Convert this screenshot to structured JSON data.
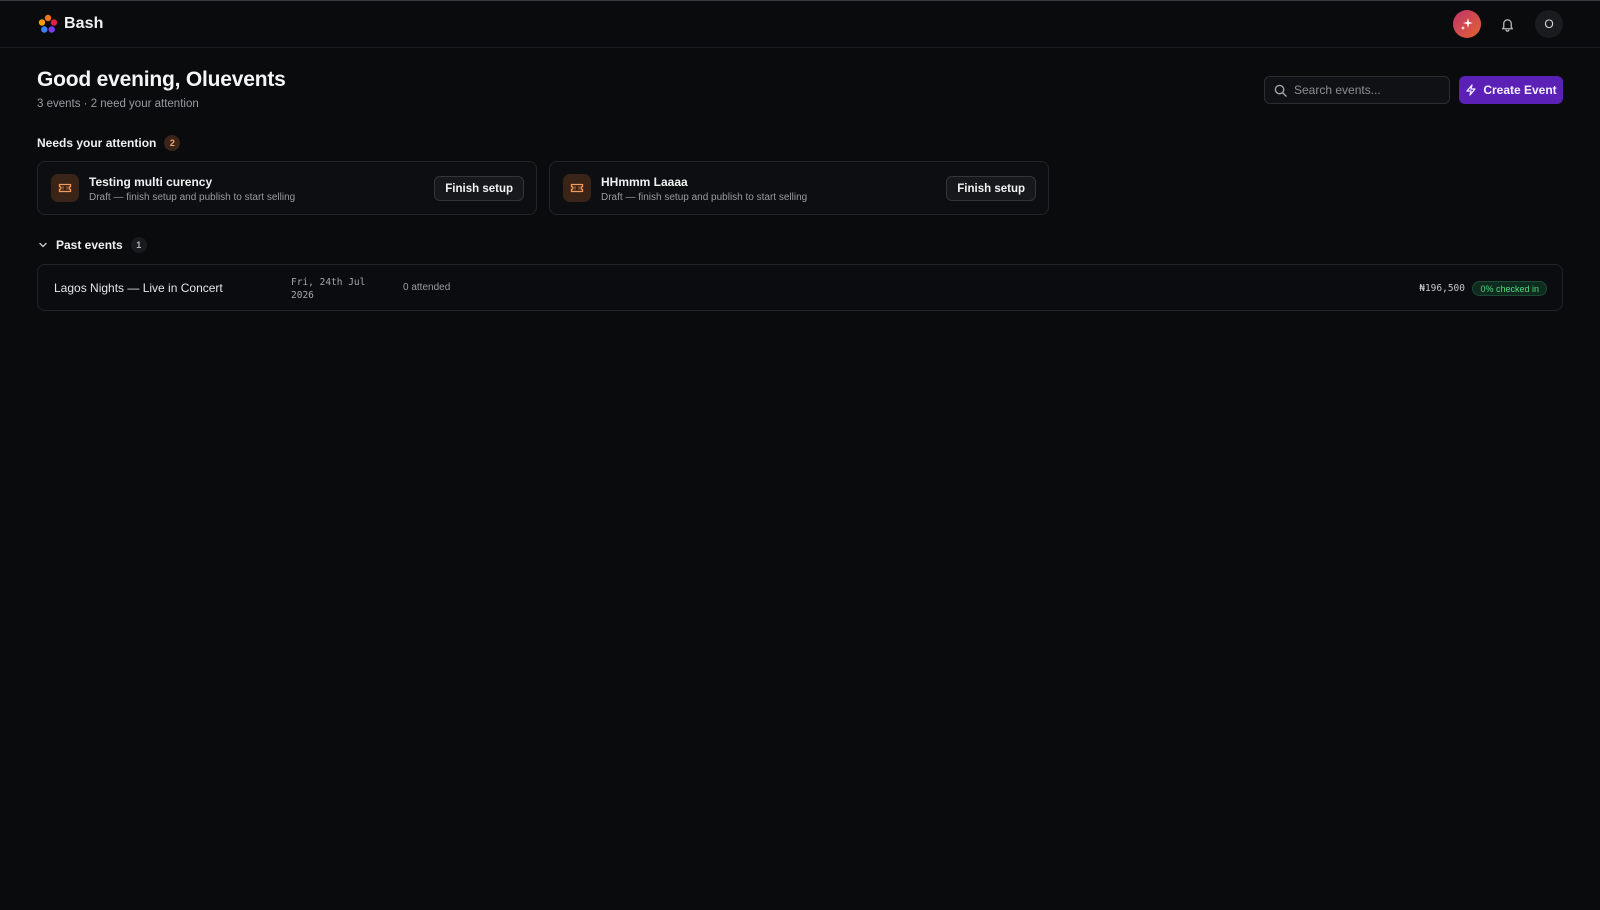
{
  "app": {
    "name": "Bash",
    "avatar_initial": "O"
  },
  "header": {
    "greeting": "Good evening, Oluevents",
    "subline": "3 events · 2 need your attention"
  },
  "search": {
    "placeholder": "Search events...",
    "value": ""
  },
  "create_button": {
    "label": "Create Event"
  },
  "attention": {
    "title": "Needs your attention",
    "count": "2",
    "items": [
      {
        "title": "Testing multi curency",
        "description": "Draft — finish setup and publish to start selling",
        "action": "Finish setup"
      },
      {
        "title": "HHmmm Laaaa",
        "description": "Draft — finish setup and publish to start selling",
        "action": "Finish setup"
      }
    ]
  },
  "past_events": {
    "title": "Past events",
    "count": "1",
    "items": [
      {
        "name": "Lagos Nights — Live in Concert",
        "date_line1": "Fri, 24th Jul",
        "date_line2": "2026",
        "attended": "0 attended",
        "amount": "₦196,500",
        "status": "0% checked in"
      }
    ]
  },
  "colors": {
    "background": "#0a0b0d",
    "accent": "#5b21b6",
    "warning": "#f4a36a",
    "success": "#4ade80"
  },
  "icons": {
    "logo": "bash-logo-icon",
    "spark": "sparkles-icon",
    "bell": "bell-icon",
    "search": "search-icon",
    "bolt": "lightning-icon",
    "ticket": "ticket-icon",
    "chevron": "chevron-down-icon"
  }
}
